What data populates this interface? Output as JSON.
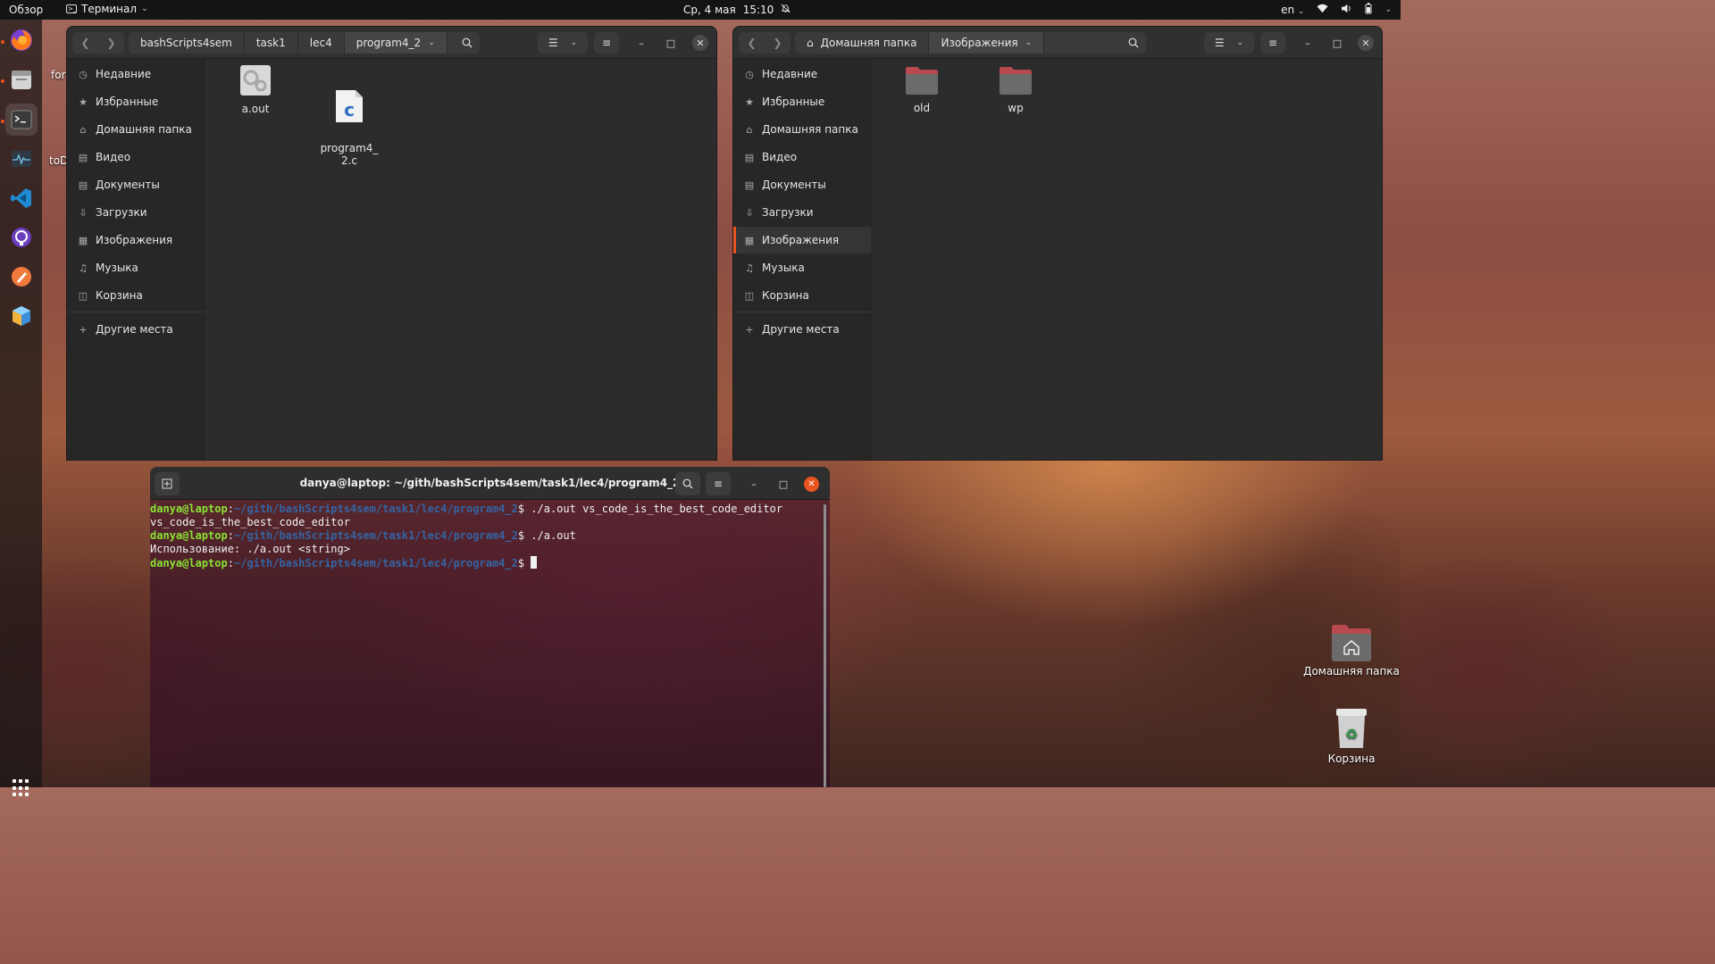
{
  "topbar": {
    "activities": "Обзор",
    "app_name": "Терминал",
    "date": "Ср, 4 мая",
    "time": "15:10",
    "language": "en"
  },
  "dock": {
    "apps": [
      "firefox-icon",
      "files-icon",
      "terminal-icon",
      "system-monitor-icon",
      "vscode-icon",
      "github-desktop-icon",
      "drawing-icon",
      "app-icon"
    ]
  },
  "desktop_partial": {
    "left_text_1": "for",
    "left_text_2": "toD"
  },
  "file_window_left": {
    "breadcrumbs": [
      "bashScripts4sem",
      "task1",
      "lec4",
      "program4_2"
    ],
    "sidebar": [
      "Недавние",
      "Избранные",
      "Домашняя папка",
      "Видео",
      "Документы",
      "Загрузки",
      "Изображения",
      "Музыка",
      "Корзина"
    ],
    "other_places": "Другие места",
    "files": [
      {
        "name": "a.out",
        "type": "executable"
      },
      {
        "name": "program4_\n2.c",
        "type": "c-source"
      }
    ]
  },
  "file_window_right": {
    "breadcrumbs": [
      "Домашняя папка",
      "Изображения"
    ],
    "sidebar": [
      "Недавние",
      "Избранные",
      "Домашняя папка",
      "Видео",
      "Документы",
      "Загрузки",
      "Изображения",
      "Музыка",
      "Корзина"
    ],
    "selected_sidebar": "Изображения",
    "other_places": "Другие места",
    "files": [
      {
        "name": "old",
        "type": "folder"
      },
      {
        "name": "wp",
        "type": "folder"
      }
    ]
  },
  "terminal": {
    "title": "danya@laptop: ~/gith/bashScripts4sem/task1/lec4/program4_2",
    "prompt_user": "danya@laptop",
    "prompt_path": "~/gith/bashScripts4sem/task1/lec4/program4_2",
    "lines": [
      {
        "type": "prompt",
        "cmd": " ./a.out vs_code_is_the_best_code_editor"
      },
      {
        "type": "output",
        "text": "vs_code_is_the_best_code_editor"
      },
      {
        "type": "prompt",
        "cmd": " ./a.out"
      },
      {
        "type": "output",
        "text": "Использование: ./a.out <string>"
      },
      {
        "type": "prompt",
        "cmd": " "
      }
    ]
  },
  "desktop_icons": {
    "home": "Домашняя папка",
    "trash": "Корзина"
  }
}
